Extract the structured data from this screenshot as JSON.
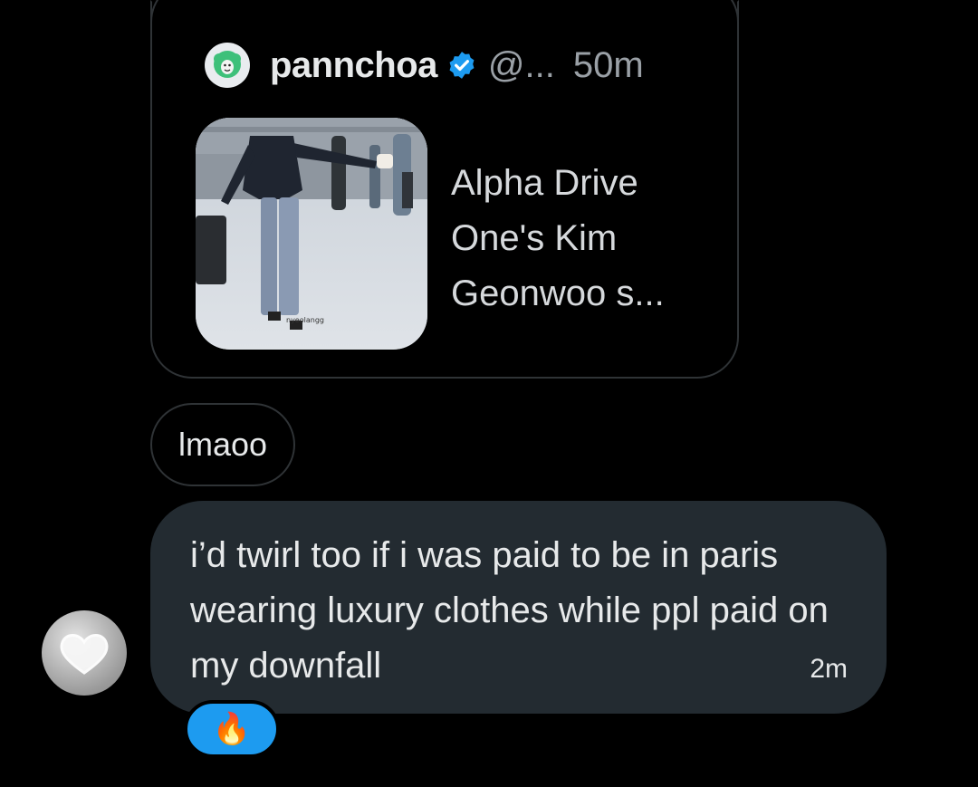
{
  "quote": {
    "author_name": "pannchoa",
    "handle": "@...",
    "time_ago": "50m",
    "preview_text": "Alpha Drive One's Kim Geonwoo s...",
    "thumbnail_watermark": "nyeolangg"
  },
  "reply_label": "lmaoo",
  "message": {
    "text": "i’d twirl too if i was paid to be in paris wearing luxury clothes while ppl paid on my downfall",
    "time": "2m"
  },
  "reaction": {
    "emoji": "🔥"
  },
  "icons": {
    "verified": "verified-badge-icon",
    "author_avatar": "sheep-logo-icon",
    "sender_avatar": "cloud-heart-avatar"
  },
  "colors": {
    "accent": "#1d9bf0",
    "bubble": "#232b31",
    "border": "#2f3336"
  }
}
